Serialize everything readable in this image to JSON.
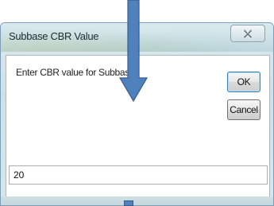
{
  "dialog": {
    "title": "Subbase CBR Value",
    "prompt": "Enter CBR value for Subbase",
    "ok_label": "OK",
    "cancel_label": "Cancel",
    "input_value": "20"
  },
  "icons": {
    "close": "close-icon",
    "annotation": "arrow-down-icon"
  },
  "colors": {
    "arrow_fill": "#4f81bd",
    "arrow_stroke": "#385d8a",
    "titlebar": "#d3e5e9"
  }
}
